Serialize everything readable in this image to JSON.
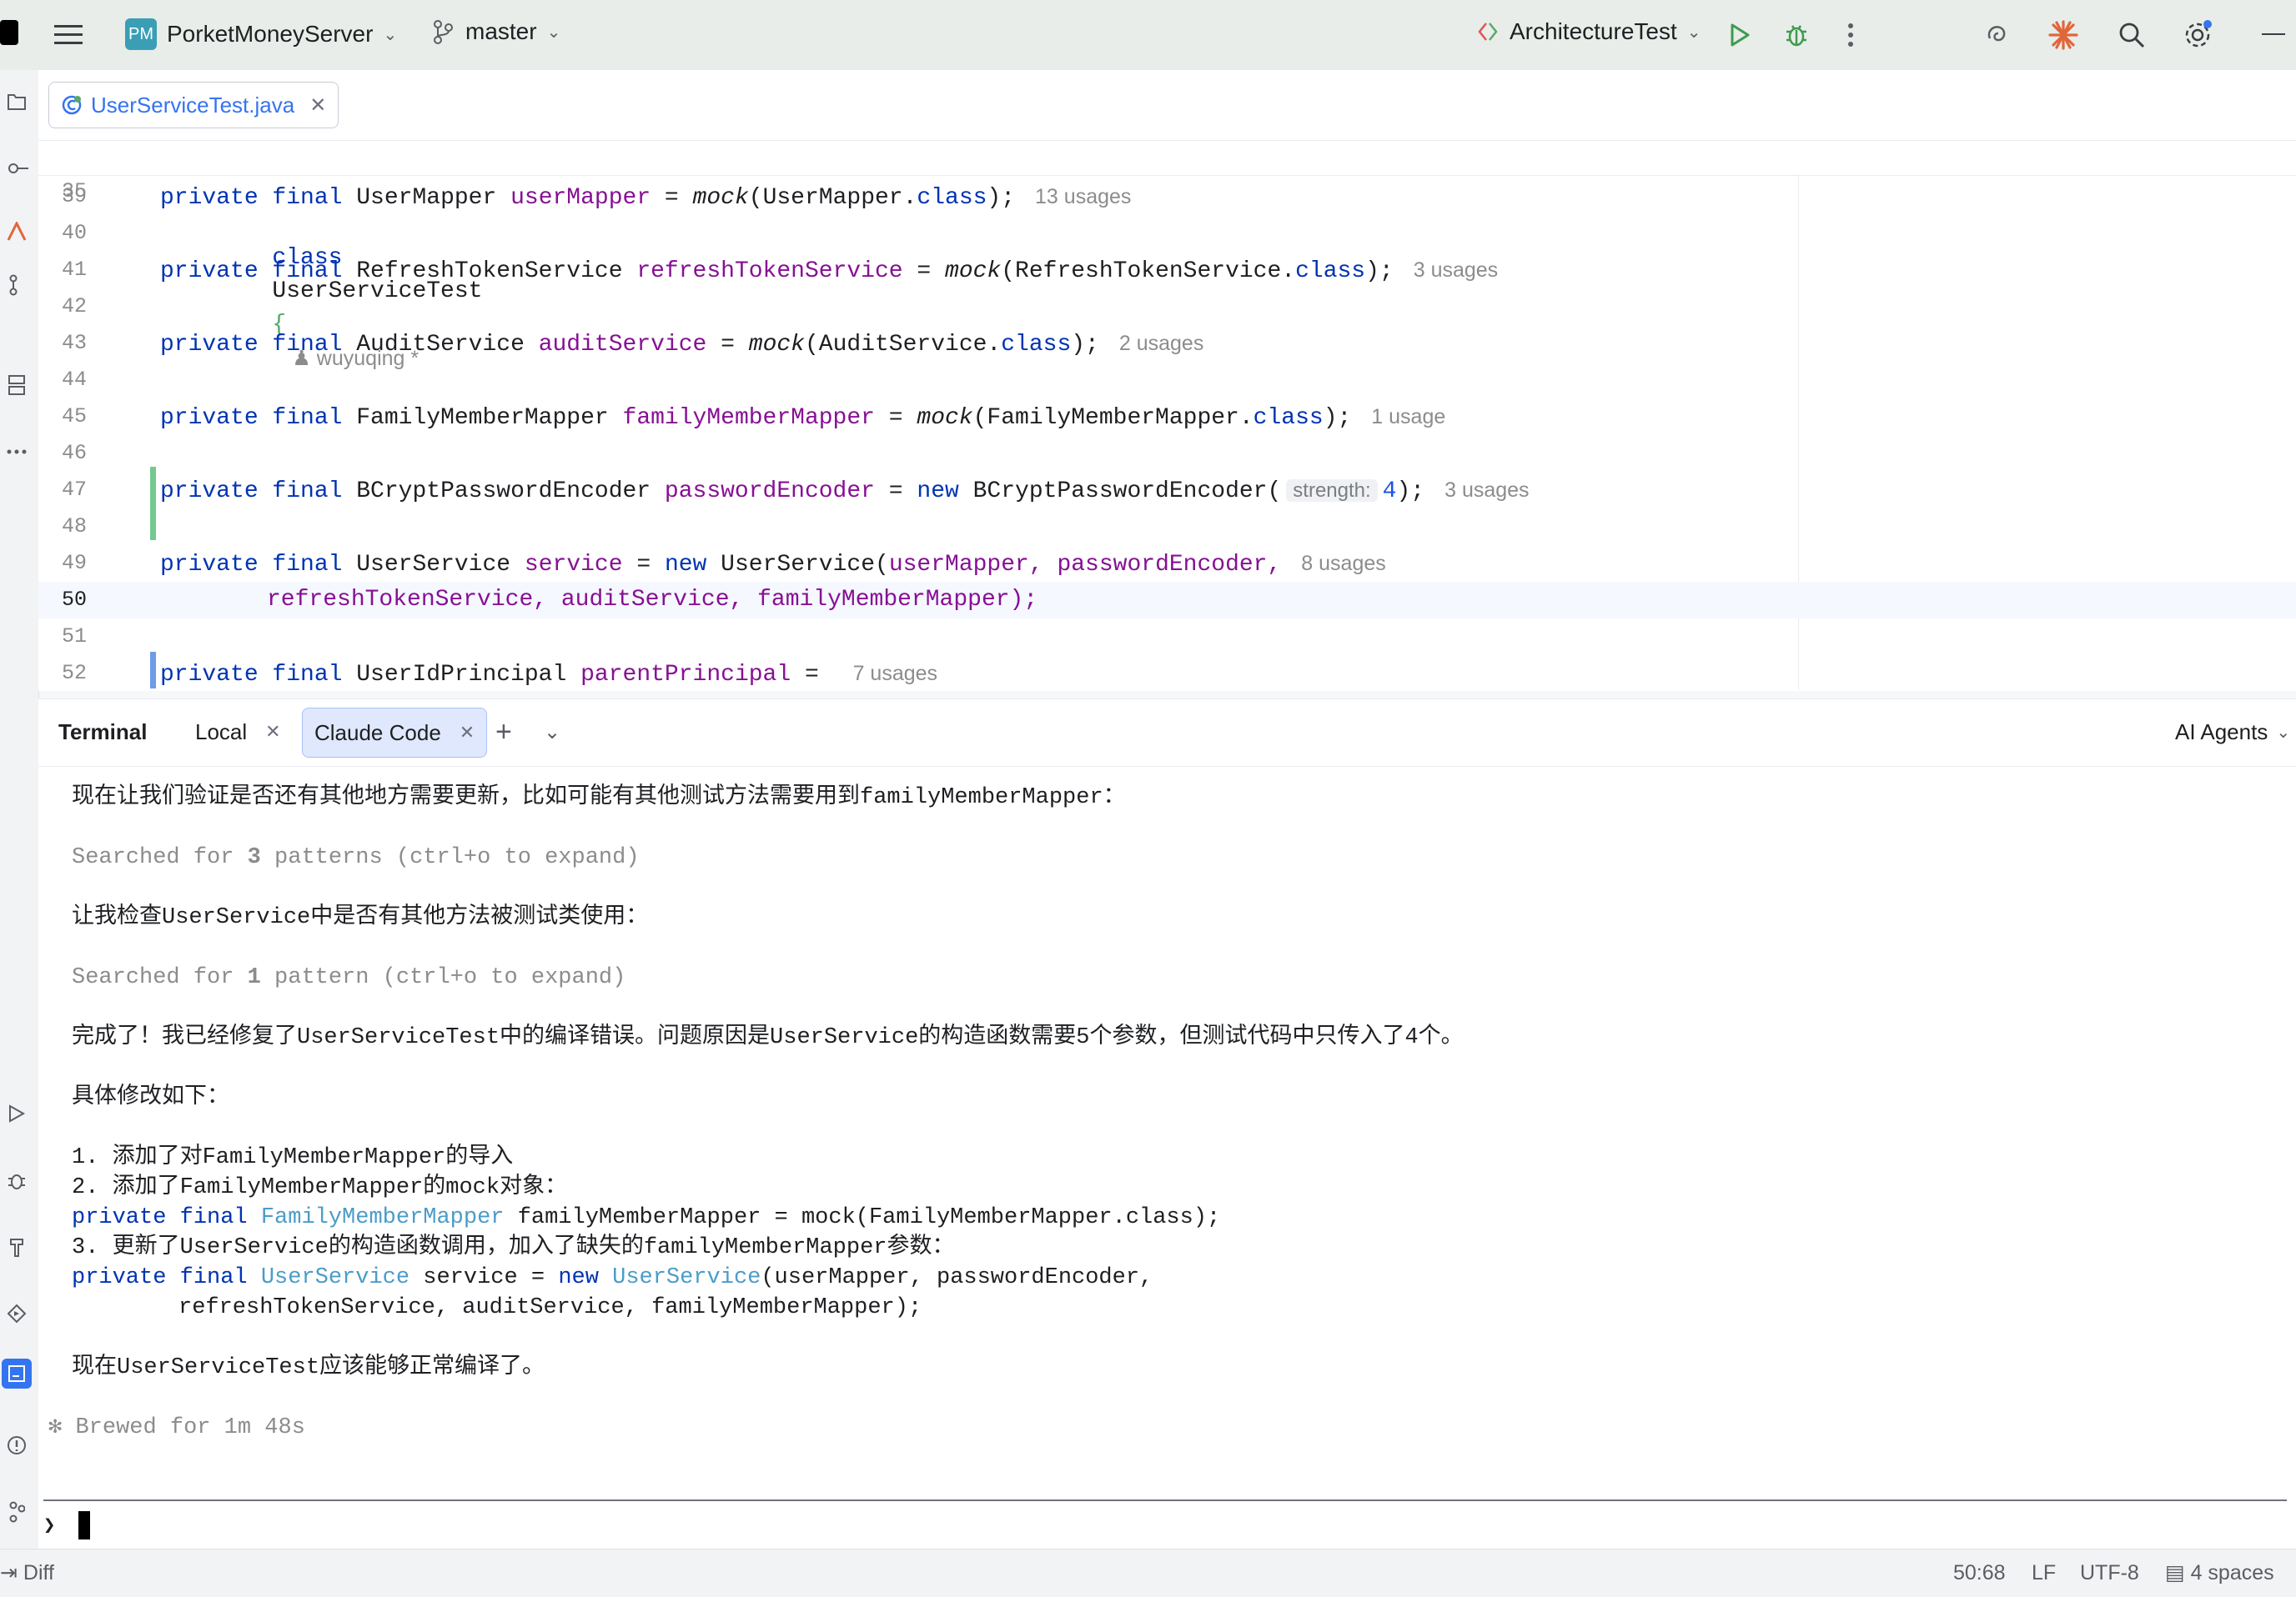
{
  "titlebar": {
    "project_badge": "PM",
    "project_name": "PorketMoneyServer",
    "branch": "master",
    "run_config": "ArchitectureTest"
  },
  "editor": {
    "tab_label": "UserServiceTest.java",
    "sticky_line": {
      "number": "35",
      "kw": "class",
      "name": "UserServiceTest",
      "brace": "{",
      "author": "wuyuqing *"
    },
    "lines": [
      {
        "n": "39",
        "kw": "private final",
        "type": "UserMapper",
        "field": "userMapper",
        "eq": " = ",
        "call": "mock",
        "arg": "(UserMapper.",
        "cls": "class",
        "tail": ");",
        "hint": "13 usages"
      },
      {
        "n": "40"
      },
      {
        "n": "41",
        "kw": "private final",
        "type": "RefreshTokenService",
        "field": "refreshTokenService",
        "eq": " = ",
        "call": "mock",
        "arg": "(RefreshTokenService.",
        "cls": "class",
        "tail": ");",
        "hint": "3 usages"
      },
      {
        "n": "42"
      },
      {
        "n": "43",
        "kw": "private final",
        "type": "AuditService",
        "field": "auditService",
        "eq": " = ",
        "call": "mock",
        "arg": "(AuditService.",
        "cls": "class",
        "tail": ");",
        "hint": "2 usages"
      },
      {
        "n": "44"
      },
      {
        "n": "45",
        "kw": "private final",
        "type": "FamilyMemberMapper",
        "field": "familyMemberMapper",
        "eq": " = ",
        "call": "mock",
        "arg": "(FamilyMemberMapper.",
        "cls": "class",
        "tail": ");",
        "hint": "1 usage"
      },
      {
        "n": "46"
      },
      {
        "n": "47",
        "kw": "private final",
        "type": "BCryptPasswordEncoder",
        "field": "passwordEncoder",
        "eq": " = ",
        "newkw": "new",
        "ctor": " BCryptPasswordEncoder(",
        "param": "strength:",
        "numval": "4",
        "tail": ");",
        "hint": "3 usages"
      },
      {
        "n": "48"
      },
      {
        "n": "49",
        "kw": "private final",
        "type": "UserService",
        "field": "service",
        "eq": " = ",
        "newkw": "new",
        "ctor": " UserService(",
        "args": "userMapper, passwordEncoder,",
        "hint": "8 usages"
      },
      {
        "n": "50",
        "cont": "refreshTokenService, auditService, familyMemberMapper);"
      },
      {
        "n": "51"
      },
      {
        "n": "52",
        "kw": "private final",
        "type": "UserIdPrincipal",
        "field": "parentPrincipal",
        "eq": " = ",
        "hint": "7 usages"
      }
    ]
  },
  "terminal": {
    "tabs": {
      "title": "Terminal",
      "local": "Local",
      "claude": "Claude Code",
      "agents": "AI Agents"
    },
    "lines": [
      "现在让我们验证是否还有其他地方需要更新，比如可能有其他测试方法需要用到familyMemberMapper：",
      "Searched for ",
      "3",
      " patterns (ctrl+o to expand)",
      "让我检查UserService中是否有其他方法被测试类使用：",
      "Searched for ",
      "1",
      " pattern (ctrl+o to expand)",
      "完成了！我已经修复了UserServiceTest中的编译错误。问题原因是UserService的构造函数需要5个参数，但测试代码中只传入了4个。",
      "具体修改如下：",
      "1. 添加了对FamilyMemberMapper的导入",
      "2. 添加了FamilyMemberMapper的mock对象：",
      "private final",
      "FamilyMemberMapper",
      " familyMemberMapper = mock(FamilyMemberMapper.class);",
      "3. 更新了UserService的构造函数调用，加入了缺失的familyMemberMapper参数：",
      "private final",
      "UserService",
      " service = ",
      "new",
      "UserService",
      "(userMapper, passwordEncoder,",
      "refreshTokenService, auditService, familyMemberMapper);",
      "现在UserServiceTest应该能够正常编译了。",
      "✻ Brewed for 1m 48s",
      "❯"
    ]
  },
  "statusbar": {
    "diff": "Diff",
    "position": "50:68",
    "line_sep": "LF",
    "encoding": "UTF-8",
    "indent": "4 spaces"
  }
}
